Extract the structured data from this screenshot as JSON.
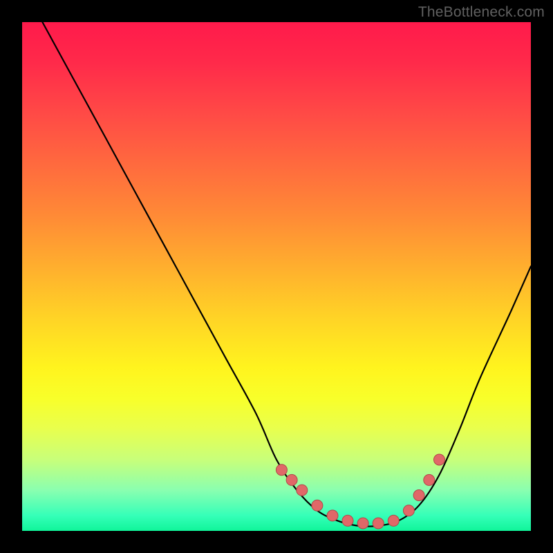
{
  "watermark": "TheBottleneck.com",
  "colors": {
    "page_bg": "#000000",
    "gradient_top": "#ff1a4b",
    "gradient_mid": "#fff41e",
    "gradient_bottom": "#10f59a",
    "curve_stroke": "#000000",
    "dot_fill": "#e06868",
    "dot_stroke": "#b04848"
  },
  "chart_data": {
    "type": "line",
    "title": "",
    "xlabel": "",
    "ylabel": "",
    "xlim": [
      0,
      100
    ],
    "ylim": [
      0,
      100
    ],
    "grid": false,
    "series": [
      {
        "name": "bottleneck-curve",
        "x": [
          4,
          10,
          16,
          22,
          28,
          34,
          40,
          46,
          50,
          54,
          58,
          62,
          66,
          70,
          74,
          78,
          82,
          86,
          90,
          96,
          100
        ],
        "values": [
          100,
          89,
          78,
          67,
          56,
          45,
          34,
          23,
          14,
          8,
          4,
          2,
          1,
          1,
          2,
          5,
          11,
          20,
          30,
          43,
          52
        ]
      }
    ],
    "dots": {
      "name": "highlight-points",
      "x": [
        51,
        53,
        55,
        58,
        61,
        64,
        67,
        70,
        73,
        76,
        78,
        80,
        82
      ],
      "values": [
        12,
        10,
        8,
        5,
        3,
        2,
        1.5,
        1.5,
        2,
        4,
        7,
        10,
        14
      ]
    }
  }
}
